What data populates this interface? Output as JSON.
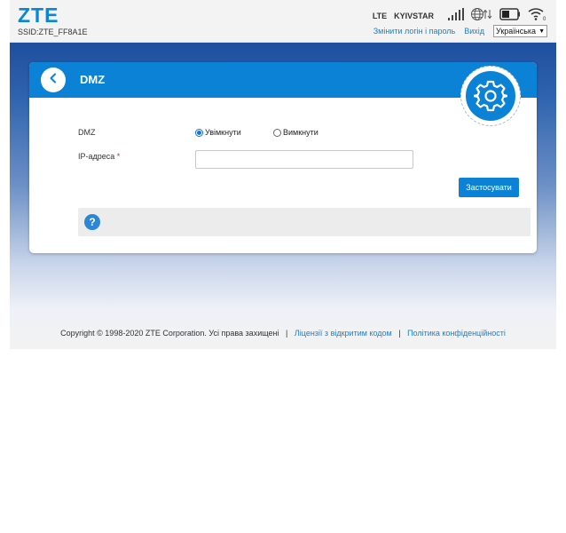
{
  "header": {
    "logo": "ZTE",
    "ssid": "SSID:ZTE_FF8A1E",
    "network_type": "LTE",
    "operator": "KYIVSTAR",
    "sim_badge": "0",
    "change_login_link": "Змінити логін і пароль",
    "logout_link": "Вихід",
    "language": "Українська"
  },
  "card": {
    "title": "DMZ",
    "dmz_label": "DMZ",
    "option_on": "Увімкнути",
    "option_off": "Вимкнути",
    "selected": "on",
    "ip_label": "IP-адреса",
    "required_mark": "*",
    "ip_value": "",
    "apply_label": "Застосувати",
    "help_symbol": "?"
  },
  "footer": {
    "copyright": "Copyright © 1998-2020 ZTE Corporation. Усі права захищені",
    "separator": "|",
    "open_source_link": "Ліцензії з відкритим кодом",
    "privacy_link": "Політика конфіденційності"
  },
  "colors": {
    "brand_blue": "#0b82d6",
    "link_blue": "#1a7fd0",
    "required_red": "#e0262a"
  }
}
